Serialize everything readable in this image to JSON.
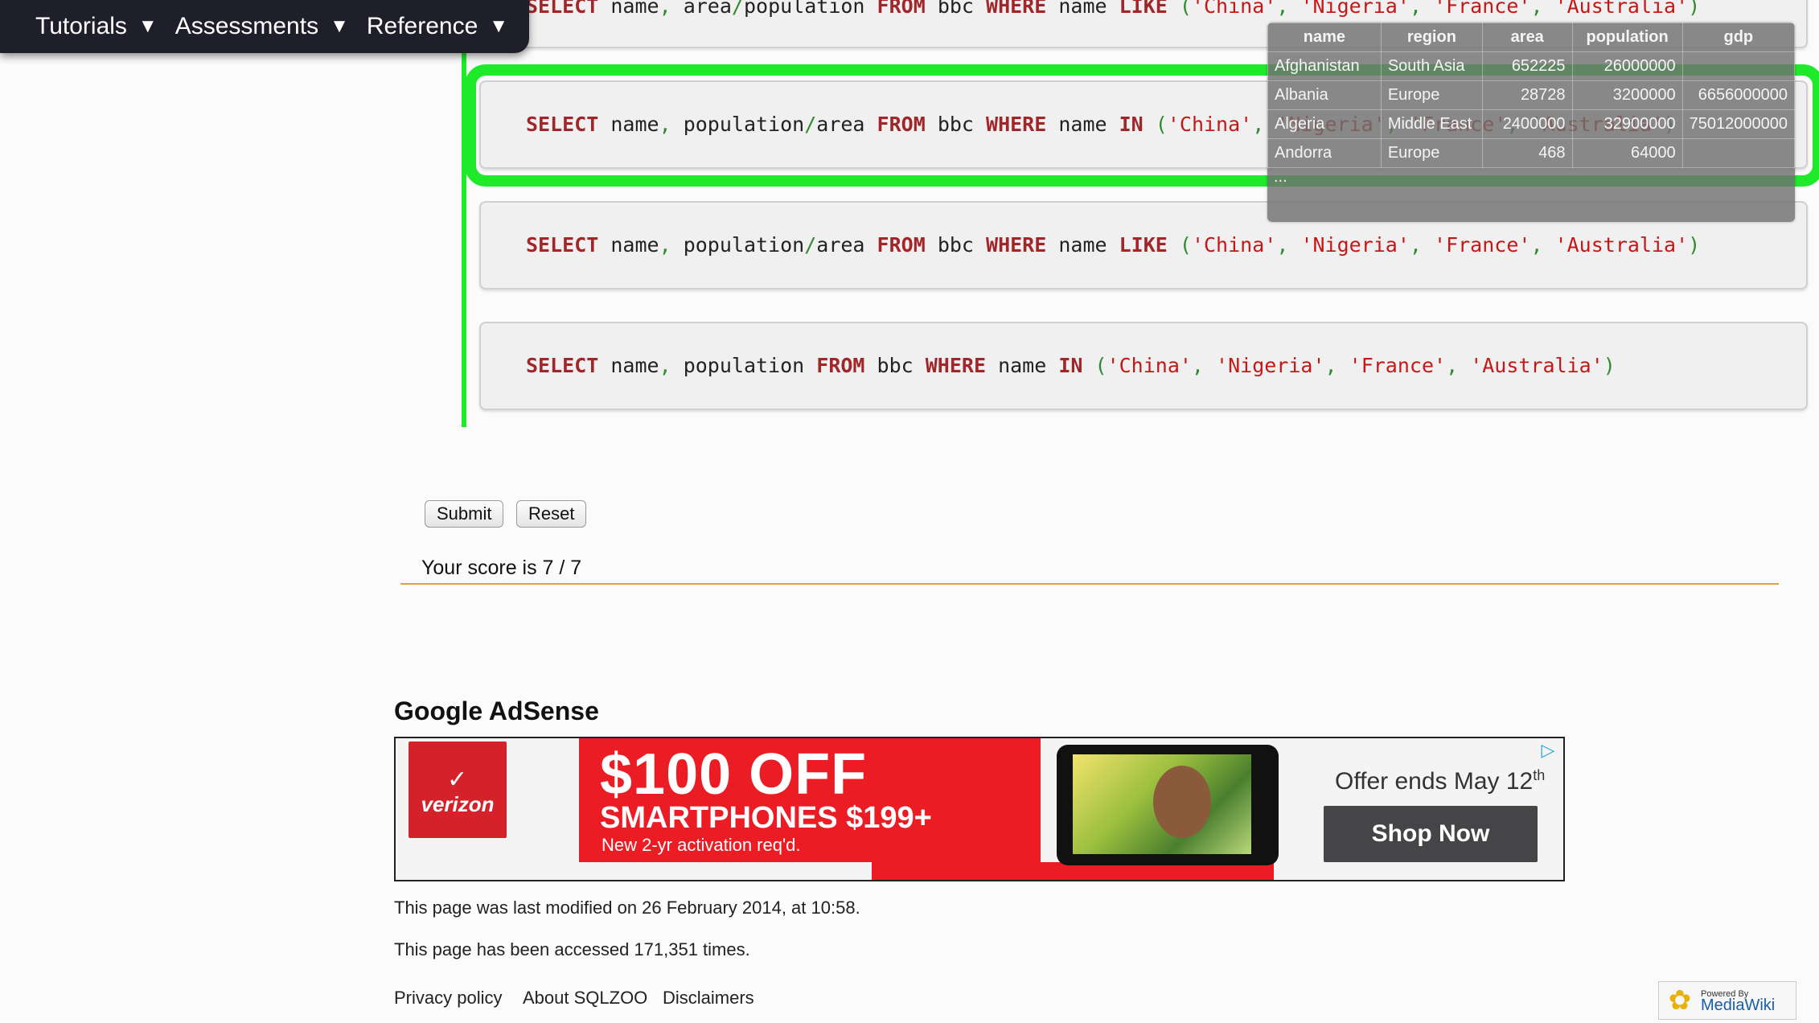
{
  "nav": {
    "items": [
      {
        "label": "Tutorials"
      },
      {
        "label": "Assessments"
      },
      {
        "label": "Reference"
      }
    ],
    "arrow": "▼"
  },
  "queries": [
    {
      "tokens": [
        {
          "t": "kw",
          "v": "SELECT"
        },
        {
          "t": "tx",
          "v": " name"
        },
        {
          "t": "pn",
          "v": ","
        },
        {
          "t": "tx",
          "v": " area"
        },
        {
          "t": "pn",
          "v": "/"
        },
        {
          "t": "tx",
          "v": "population "
        },
        {
          "t": "kw",
          "v": "FROM"
        },
        {
          "t": "tx",
          "v": " bbc "
        },
        {
          "t": "kw",
          "v": "WHERE"
        },
        {
          "t": "tx",
          "v": " name "
        },
        {
          "t": "kw",
          "v": "LIKE"
        },
        {
          "t": "tx",
          "v": " "
        },
        {
          "t": "pn",
          "v": "("
        },
        {
          "t": "str",
          "v": "'China'"
        },
        {
          "t": "pn",
          "v": ","
        },
        {
          "t": "tx",
          "v": " "
        },
        {
          "t": "str",
          "v": "'Nigeria'"
        },
        {
          "t": "pn",
          "v": ","
        },
        {
          "t": "tx",
          "v": " "
        },
        {
          "t": "str",
          "v": "'France'"
        },
        {
          "t": "pn",
          "v": ","
        },
        {
          "t": "tx",
          "v": " "
        },
        {
          "t": "str",
          "v": "'Australia'"
        },
        {
          "t": "pn",
          "v": ")"
        }
      ]
    },
    {
      "tokens": [
        {
          "t": "kw",
          "v": "SELECT"
        },
        {
          "t": "tx",
          "v": " name"
        },
        {
          "t": "pn",
          "v": ","
        },
        {
          "t": "tx",
          "v": " population"
        },
        {
          "t": "pn",
          "v": "/"
        },
        {
          "t": "tx",
          "v": "area "
        },
        {
          "t": "kw",
          "v": "FROM"
        },
        {
          "t": "tx",
          "v": " bbc "
        },
        {
          "t": "kw",
          "v": "WHERE"
        },
        {
          "t": "tx",
          "v": " name "
        },
        {
          "t": "kw",
          "v": "IN"
        },
        {
          "t": "tx",
          "v": " "
        },
        {
          "t": "pn",
          "v": "("
        },
        {
          "t": "str",
          "v": "'China'"
        },
        {
          "t": "pn",
          "v": ","
        },
        {
          "t": "tx",
          "v": " "
        },
        {
          "t": "str",
          "v": "'Nigeria'"
        },
        {
          "t": "pn",
          "v": ","
        },
        {
          "t": "tx",
          "v": " "
        },
        {
          "t": "str",
          "v": "'France'"
        },
        {
          "t": "pn",
          "v": ","
        },
        {
          "t": "tx",
          "v": " "
        },
        {
          "t": "str",
          "v": "'Australia'"
        },
        {
          "t": "pn",
          "v": ")"
        }
      ]
    },
    {
      "tokens": [
        {
          "t": "kw",
          "v": "SELECT"
        },
        {
          "t": "tx",
          "v": " name"
        },
        {
          "t": "pn",
          "v": ","
        },
        {
          "t": "tx",
          "v": " population"
        },
        {
          "t": "pn",
          "v": "/"
        },
        {
          "t": "tx",
          "v": "area "
        },
        {
          "t": "kw",
          "v": "FROM"
        },
        {
          "t": "tx",
          "v": " bbc "
        },
        {
          "t": "kw",
          "v": "WHERE"
        },
        {
          "t": "tx",
          "v": " name "
        },
        {
          "t": "kw",
          "v": "LIKE"
        },
        {
          "t": "tx",
          "v": " "
        },
        {
          "t": "pn",
          "v": "("
        },
        {
          "t": "str",
          "v": "'China'"
        },
        {
          "t": "pn",
          "v": ","
        },
        {
          "t": "tx",
          "v": " "
        },
        {
          "t": "str",
          "v": "'Nigeria'"
        },
        {
          "t": "pn",
          "v": ","
        },
        {
          "t": "tx",
          "v": " "
        },
        {
          "t": "str",
          "v": "'France'"
        },
        {
          "t": "pn",
          "v": ","
        },
        {
          "t": "tx",
          "v": " "
        },
        {
          "t": "str",
          "v": "'Australia'"
        },
        {
          "t": "pn",
          "v": ")"
        }
      ]
    },
    {
      "tokens": [
        {
          "t": "kw",
          "v": "SELECT"
        },
        {
          "t": "tx",
          "v": " name"
        },
        {
          "t": "pn",
          "v": ","
        },
        {
          "t": "tx",
          "v": " population "
        },
        {
          "t": "kw",
          "v": "FROM"
        },
        {
          "t": "tx",
          "v": " bbc "
        },
        {
          "t": "kw",
          "v": "WHERE"
        },
        {
          "t": "tx",
          "v": " name "
        },
        {
          "t": "kw",
          "v": "IN"
        },
        {
          "t": "tx",
          "v": " "
        },
        {
          "t": "pn",
          "v": "("
        },
        {
          "t": "str",
          "v": "'China'"
        },
        {
          "t": "pn",
          "v": ","
        },
        {
          "t": "tx",
          "v": " "
        },
        {
          "t": "str",
          "v": "'Nigeria'"
        },
        {
          "t": "pn",
          "v": ","
        },
        {
          "t": "tx",
          "v": " "
        },
        {
          "t": "str",
          "v": "'France'"
        },
        {
          "t": "pn",
          "v": ","
        },
        {
          "t": "tx",
          "v": " "
        },
        {
          "t": "str",
          "v": "'Australia'"
        },
        {
          "t": "pn",
          "v": ")"
        }
      ]
    }
  ],
  "tooltip": {
    "headers": [
      "name",
      "region",
      "area",
      "population",
      "gdp"
    ],
    "rows": [
      [
        "Afghanistan",
        "South Asia",
        "652225",
        "26000000",
        ""
      ],
      [
        "Albania",
        "Europe",
        "28728",
        "3200000",
        "6656000000"
      ],
      [
        "Algeria",
        "Middle East",
        "2400000",
        "32900000",
        "75012000000"
      ],
      [
        "Andorra",
        "Europe",
        "468",
        "64000",
        ""
      ]
    ],
    "ellipsis": "..."
  },
  "buttons": {
    "submit": "Submit",
    "reset": "Reset"
  },
  "score": "Your score is 7 / 7",
  "ad": {
    "heading": "Google AdSense",
    "brand": "verizon",
    "headline": "$100 OFF",
    "subhead": "SMARTPHONES $199+",
    "fine_print": "New 2-yr activation req'd.",
    "offer": "Offer ends May 12",
    "offer_sup": "th",
    "cta": "Shop Now",
    "choice_icon": "▷"
  },
  "footer": {
    "modified": "This page was last modified on 26 February 2014, at 10:58.",
    "accessed": "This page has been accessed 171,351 times.",
    "links": [
      "Privacy policy",
      "About SQLZOO",
      "Disclaimers"
    ],
    "mw_powered": "Powered By",
    "mw_name": "MediaWiki"
  },
  "colors": {
    "highlight": "#1eea2a",
    "keyword": "#a0262a",
    "string": "#c41818",
    "nav_bg": "#1f1f2b"
  }
}
